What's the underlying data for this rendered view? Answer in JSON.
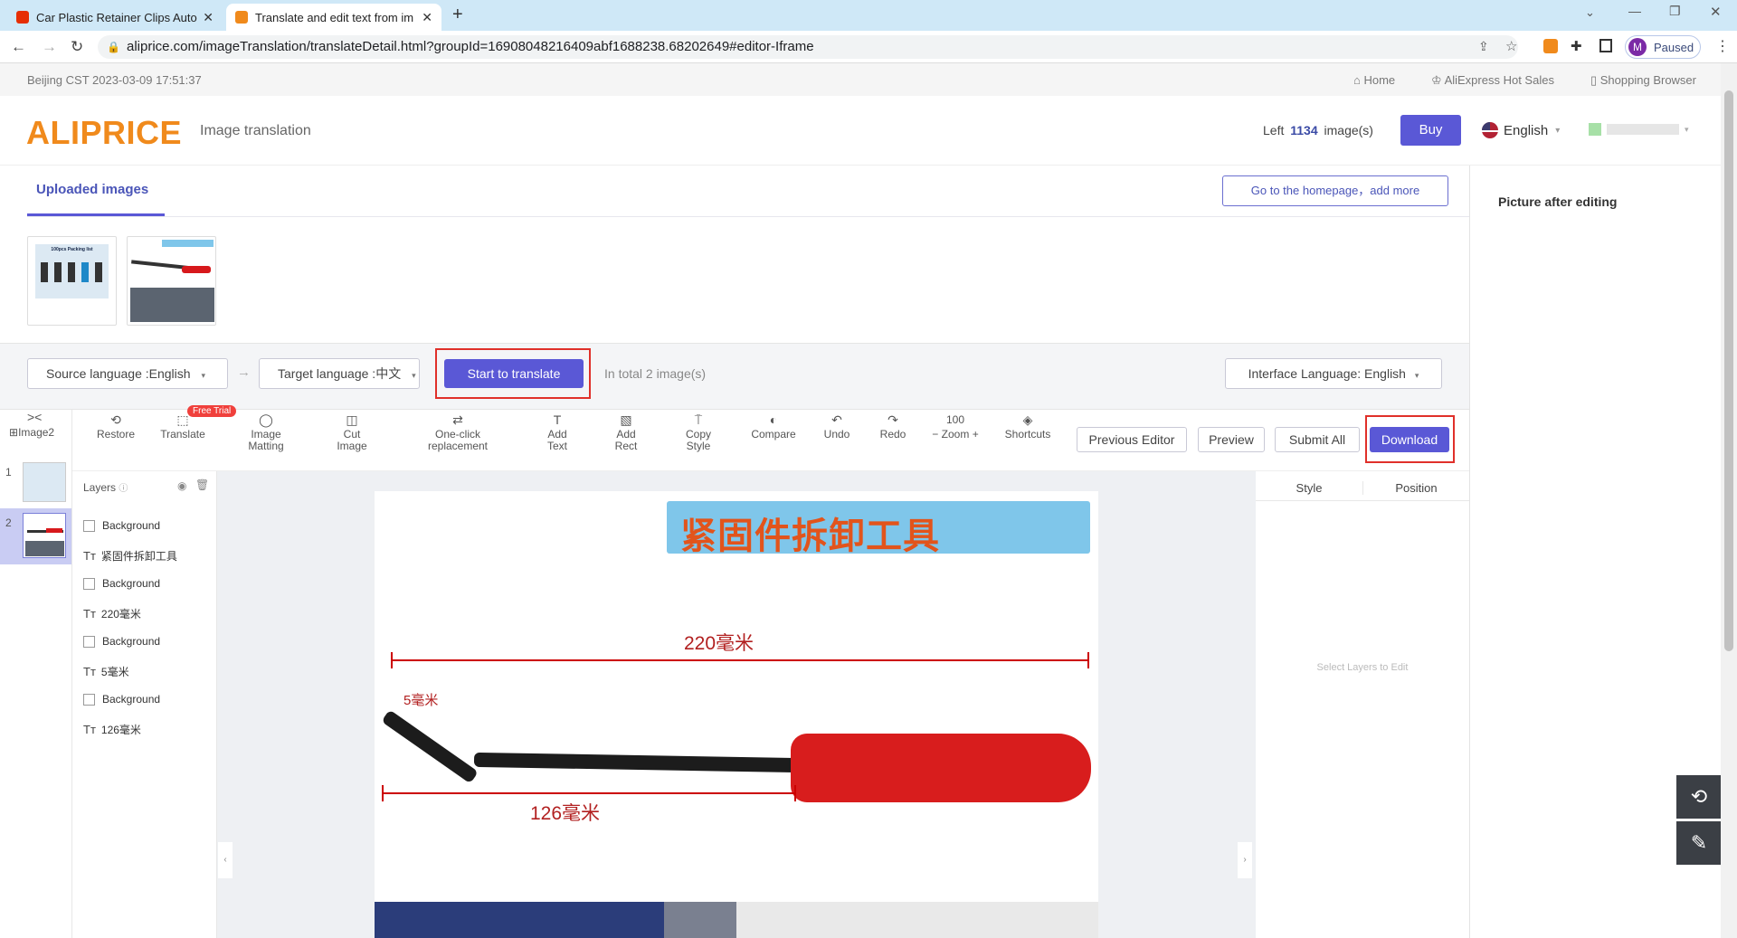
{
  "browser": {
    "tabs": [
      {
        "title": "Car Plastic Retainer Clips Auto",
        "active": false
      },
      {
        "title": "Translate and edit text from im",
        "active": true
      }
    ],
    "url": "aliprice.com/imageTranslation/translateDetail.html?groupId=16908048216409abf1688238.68202649#editor-Iframe",
    "profile_initial": "M",
    "profile_status": "Paused"
  },
  "topstrip": {
    "datetime": "Beijing CST  2023-03-09 17:51:37",
    "links": [
      "Home",
      "AliExpress Hot Sales",
      "Shopping Browser"
    ]
  },
  "header": {
    "logo": "ALIPRICE",
    "subtitle": "Image translation",
    "left_label": "Left",
    "left_count": "1134",
    "left_unit": "image(s)",
    "buy": "Buy",
    "language": "English"
  },
  "uploads": {
    "tab": "Uploaded images",
    "homepage_button": "Go to the homepage，add more",
    "thumb1_title": "100pcs Packing list"
  },
  "translate_bar": {
    "source": "Source language :English",
    "target": "Target language :中文",
    "start": "Start to translate",
    "total": "In total  2  image(s)",
    "interface": "Interface Language: English"
  },
  "editor": {
    "image_label": "Image2",
    "free_trial": "Free Trial",
    "tools": [
      {
        "icon": "restore-icon",
        "label": "Restore"
      },
      {
        "icon": "translate-icon",
        "label": "Translate"
      },
      {
        "icon": "image-matting-icon",
        "label": "Image\nMatting"
      },
      {
        "icon": "cut-image-icon",
        "label": "Cut\nImage"
      },
      {
        "icon": "replace-icon",
        "label": "One-click\nreplacement"
      },
      {
        "icon": "add-text-icon",
        "label": "Add\nText"
      },
      {
        "icon": "add-rect-icon",
        "label": "Add\nRect"
      },
      {
        "icon": "copy-style-icon",
        "label": "Copy\nStyle"
      },
      {
        "icon": "compare-icon",
        "label": "Compare"
      },
      {
        "icon": "undo-icon",
        "label": "Undo"
      },
      {
        "icon": "redo-icon",
        "label": "Redo"
      },
      {
        "icon": "shortcuts-icon",
        "label": "Shortcuts"
      }
    ],
    "zoom_value": "100",
    "zoom_label": "Zoom",
    "previous_editor": "Previous Editor",
    "preview": "Preview",
    "submit_all": "Submit All",
    "download": "Download",
    "layers_title": "Layers",
    "layers": [
      {
        "type": "rect",
        "name": "Background"
      },
      {
        "type": "text",
        "name": "紧固件拆卸工具"
      },
      {
        "type": "rect",
        "name": "Background"
      },
      {
        "type": "text",
        "name": "220毫米"
      },
      {
        "type": "rect",
        "name": "Background"
      },
      {
        "type": "text",
        "name": "5毫米"
      },
      {
        "type": "rect",
        "name": "Background"
      },
      {
        "type": "text",
        "name": "126毫米"
      }
    ],
    "thumb_numbers": [
      "1",
      "2"
    ],
    "canvas": {
      "title": "紧固件拆卸工具",
      "dim_top": "220毫米",
      "dim_small": "5毫米",
      "dim_bottom": "126毫米"
    },
    "props_tabs": [
      "Style",
      "Position"
    ],
    "props_hint": "Select Layers to Edit"
  },
  "right_panel": {
    "title": "Picture after editing"
  },
  "colors": {
    "accent": "#5a58d6",
    "logo": "#f08a1c",
    "highlight": "#e0302a"
  }
}
